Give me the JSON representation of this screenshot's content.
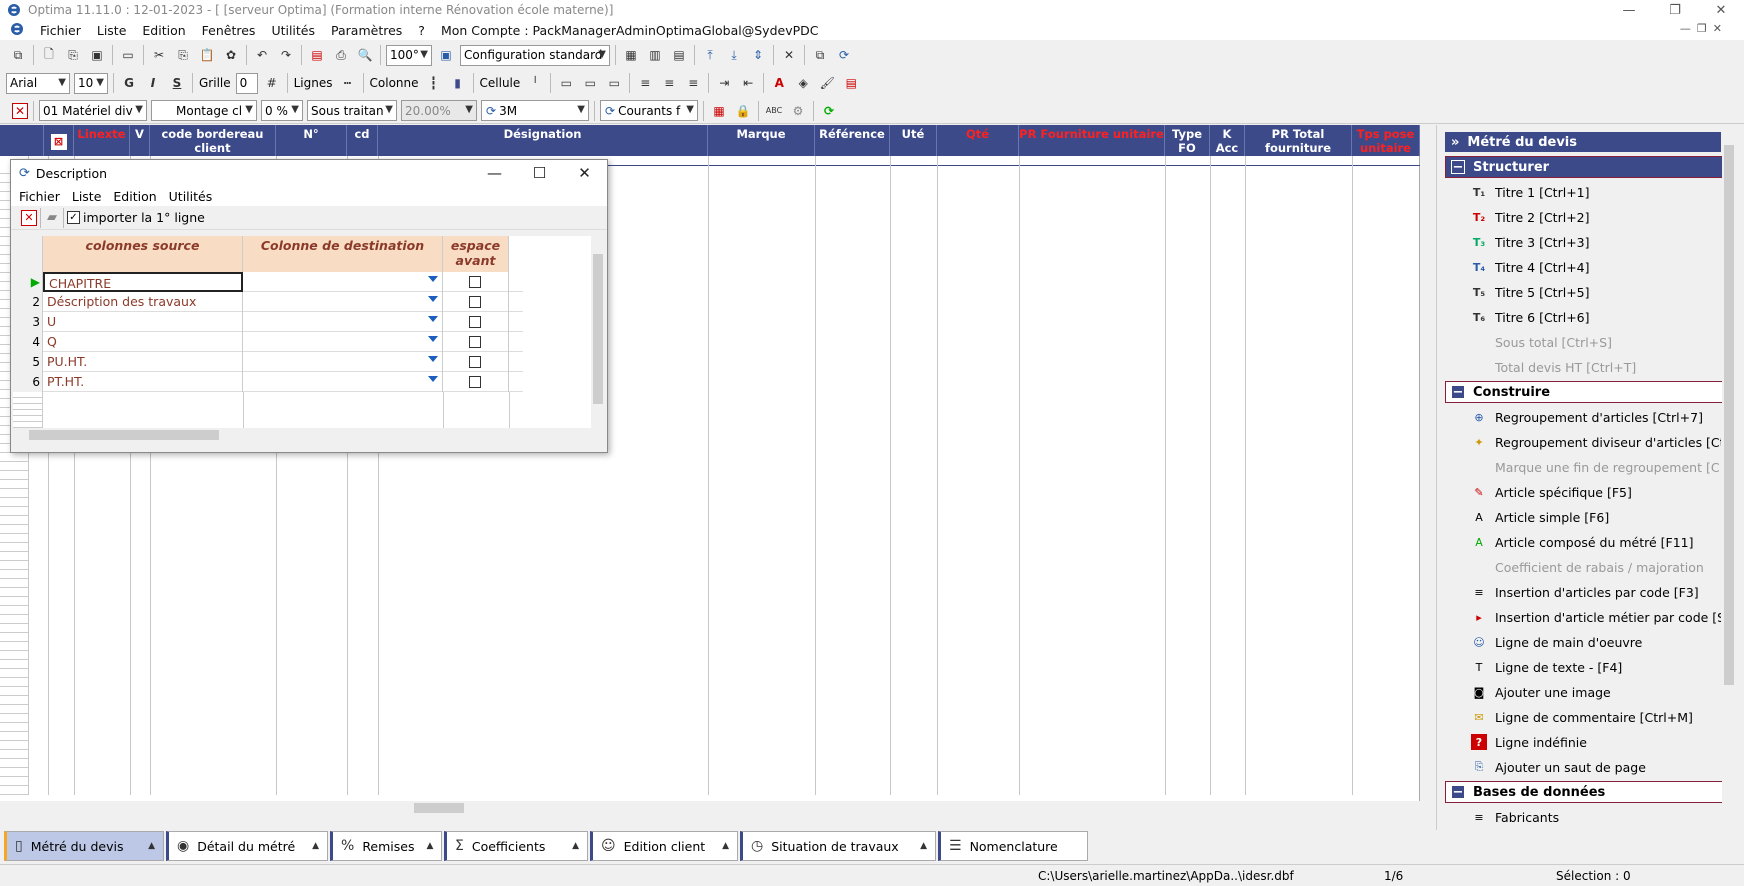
{
  "window": {
    "title": "Optima 11.11.0 : 12-01-2023 - [ [serveur Optima] (Formation interne Rénovation école materne)]",
    "minimize": "—",
    "restore": "❐",
    "close": "✕"
  },
  "menu": {
    "items": [
      "Fichier",
      "Liste",
      "Edition",
      "Fenêtres",
      "Utilités",
      "Paramètres",
      "?",
      "Mon Compte : PackManagerAdminOptimaGlobal@SydevPDC"
    ]
  },
  "toolbar1": {
    "zoom": "100°",
    "config": "Configuration standard"
  },
  "toolbar2": {
    "font": "Arial",
    "size": "10",
    "bold": "G",
    "italic": "I",
    "underline": "S",
    "grille_label": "Grille",
    "grille_value": "0",
    "lignes_label": "Lignes",
    "colonne_label": "Colonne",
    "cellule_label": "Cellule"
  },
  "toolbar3": {
    "lot": "01 Matériel div",
    "montage": "Montage cl",
    "pct": "0 %",
    "sous_traitance": "Sous traitan",
    "rate": "20.00%",
    "brand": "3M",
    "courants": "Courants f"
  },
  "grid": {
    "headers": [
      {
        "label": "Linexte",
        "red": true
      },
      {
        "label": "V",
        "red": false
      },
      {
        "label": "code bordereau client",
        "red": false
      },
      {
        "label": "N°",
        "red": false
      },
      {
        "label": "cd",
        "red": false
      },
      {
        "label": "Désignation",
        "red": false
      },
      {
        "label": "Marque",
        "red": false
      },
      {
        "label": "Référence",
        "red": false
      },
      {
        "label": "Uté",
        "red": false
      },
      {
        "label": "Qté",
        "red": true
      },
      {
        "label": "PR Fourniture unitaire",
        "red": true
      },
      {
        "label": "Type FO",
        "red": false
      },
      {
        "label": "K Acc",
        "red": false
      },
      {
        "label": "PR Total fourniture",
        "red": false
      },
      {
        "label": "Tps pose unitaire",
        "red": true
      }
    ]
  },
  "dialog": {
    "title": "Description",
    "menu": [
      "Fichier",
      "Liste",
      "Edition",
      "Utilités"
    ],
    "import_label": "importer la 1° ligne",
    "headers": {
      "source": "colonnes source",
      "dest": "Colonne de destination",
      "space": "espace avant"
    },
    "rows": [
      {
        "num": "",
        "source": "CHAPITRE"
      },
      {
        "num": "2",
        "source": "Déscription des travaux"
      },
      {
        "num": "3",
        "source": "U"
      },
      {
        "num": "4",
        "source": "Q"
      },
      {
        "num": "5",
        "source": "PU.HT."
      },
      {
        "num": "6",
        "source": "PT.HT."
      }
    ]
  },
  "panel": {
    "header": "Métré du devis",
    "sections": [
      {
        "title": "Structurer"
      },
      {
        "title": "Construire"
      },
      {
        "title": "Bases de données"
      }
    ],
    "structurer": [
      {
        "label": "Titre 1 [Ctrl+1]",
        "icon": "T1",
        "disabled": false
      },
      {
        "label": "Titre 2 [Ctrl+2]",
        "icon": "T2",
        "disabled": false
      },
      {
        "label": "Titre 3 [Ctrl+3]",
        "icon": "T3",
        "disabled": false
      },
      {
        "label": "Titre 4 [Ctrl+4]",
        "icon": "T4",
        "disabled": false
      },
      {
        "label": "Titre 5 [Ctrl+5]",
        "icon": "T5",
        "disabled": false
      },
      {
        "label": "Titre 6 [Ctrl+6]",
        "icon": "T6",
        "disabled": false
      },
      {
        "label": "Sous total [Ctrl+S]",
        "icon": "",
        "disabled": true
      },
      {
        "label": "Total devis HT [Ctrl+T]",
        "icon": "",
        "disabled": true
      }
    ],
    "construire": [
      {
        "label": "Regroupement d'articles  [Ctrl+7]",
        "icon": "⊕",
        "disabled": false
      },
      {
        "label": "Regroupement diviseur d'articles [Ctr...",
        "icon": "✦",
        "disabled": false
      },
      {
        "label": "Marque une fin de regroupement  [C...",
        "icon": "",
        "disabled": true
      },
      {
        "label": "Article spécifique [F5]",
        "icon": "✎",
        "disabled": false
      },
      {
        "label": "Article simple [F6]",
        "icon": "A",
        "disabled": false
      },
      {
        "label": "Article composé du métré [F11]",
        "icon": "A",
        "disabled": false
      },
      {
        "label": "Coefficient de rabais / majoration",
        "icon": "",
        "disabled": true
      },
      {
        "label": "Insertion d'articles par code [F3]",
        "icon": "≡",
        "disabled": false
      },
      {
        "label": "Insertion d'article métier par code [S...",
        "icon": "▸",
        "disabled": false
      },
      {
        "label": "Ligne de main d'oeuvre",
        "icon": "☺",
        "disabled": false
      },
      {
        "label": "Ligne de texte - [F4]",
        "icon": "T",
        "disabled": false
      },
      {
        "label": "Ajouter une image",
        "icon": "◙",
        "disabled": false
      },
      {
        "label": "Ligne de commentaire [Ctrl+M]",
        "icon": "✉",
        "disabled": false
      },
      {
        "label": "Ligne indéfinie",
        "icon": "?",
        "disabled": false
      },
      {
        "label": "Ajouter un saut de page",
        "icon": "⎘",
        "disabled": false
      }
    ],
    "bdd": [
      {
        "label": "Fabricants",
        "icon": "≡",
        "disabled": false
      }
    ]
  },
  "tabs": [
    {
      "label": "Métré du devis",
      "icon": "▯",
      "active": true
    },
    {
      "label": "Détail du métré",
      "icon": "◉",
      "active": false
    },
    {
      "label": "Remises",
      "icon": "%",
      "active": false
    },
    {
      "label": "Coefficients",
      "icon": "Σ",
      "active": false
    },
    {
      "label": "Edition client",
      "icon": "☺",
      "active": false
    },
    {
      "label": "Situation de travaux",
      "icon": "◷",
      "active": false
    },
    {
      "label": "Nomenclature",
      "icon": "☰",
      "active": false
    }
  ],
  "status": {
    "path": "C:\\Users\\arielle.martinez\\AppDa..\\idesr.dbf",
    "page": "1/6",
    "selection": "Sélection : 0"
  }
}
